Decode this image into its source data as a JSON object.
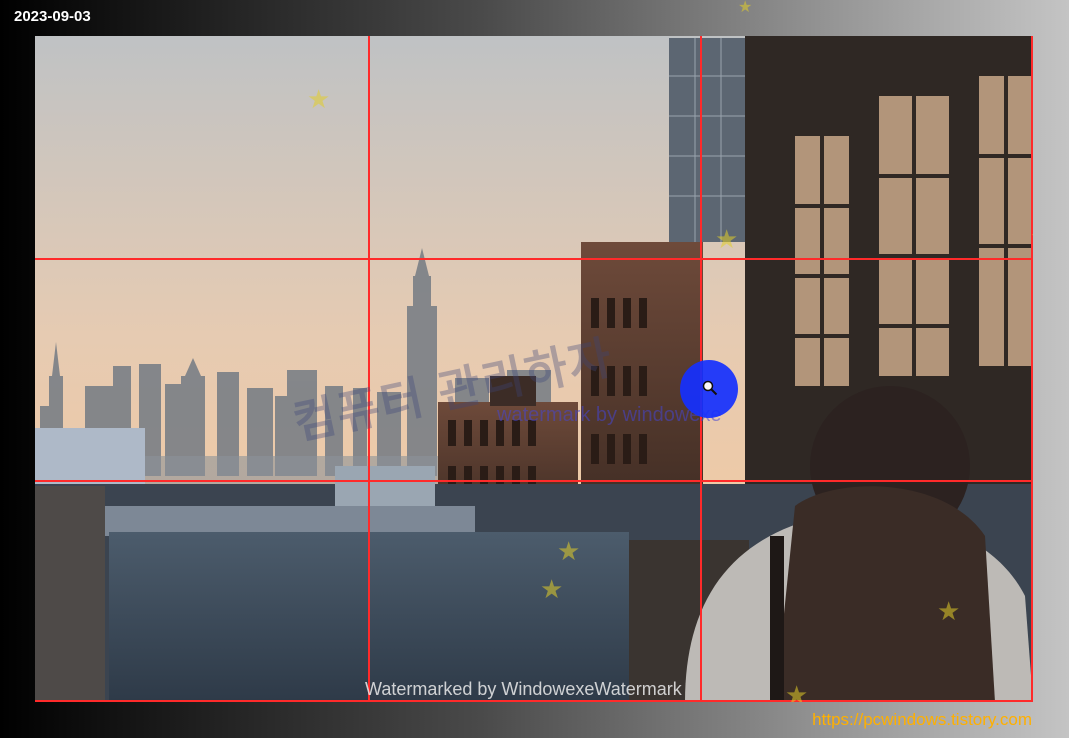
{
  "header": {
    "date": "2023-09-03"
  },
  "footer": {
    "url": "https://pcwindows.tistory.com"
  },
  "watermarks": {
    "korean": "컴퓨터 관리하자",
    "overlay": "watermark by windowexe",
    "bottom": "Watermarked by WindowexeWatermark"
  },
  "colors": {
    "grid_line": "#ff2a2a",
    "cursor": "#1530ff",
    "url_text": "#ffb000",
    "star": "#e1cd28"
  },
  "icons": {
    "cursor": "magnifier-icon",
    "stars": "star-icon"
  }
}
